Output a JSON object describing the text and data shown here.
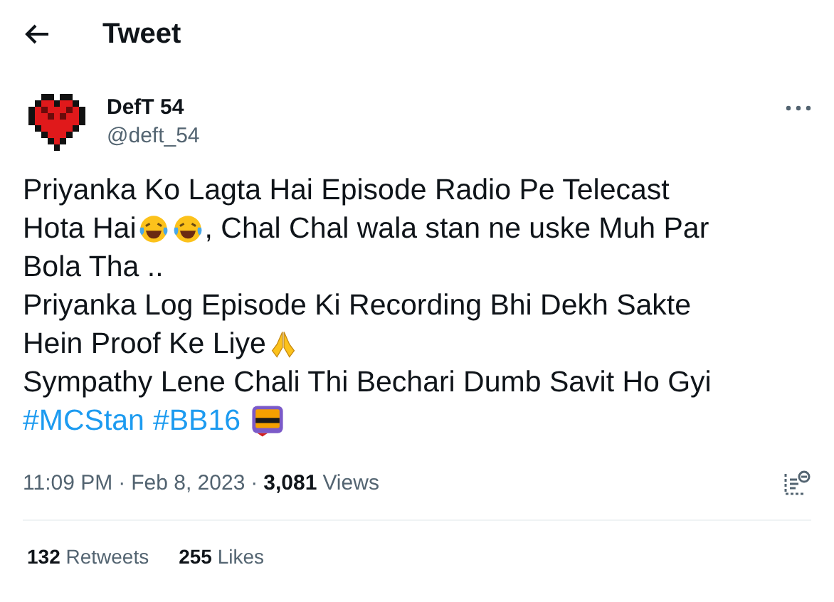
{
  "header": {
    "title": "Tweet"
  },
  "author": {
    "name": "DefT 54",
    "handle": "@deft_54"
  },
  "body": [
    [
      {
        "kind": "text",
        "text": "Priyanka Ko Lagta Hai Episode Radio Pe Telecast"
      }
    ],
    [
      {
        "kind": "text",
        "text": "Hota Hai"
      },
      {
        "kind": "laugh-emoji"
      },
      {
        "kind": "laugh-emoji"
      },
      {
        "kind": "text",
        "text": ", Chal Chal wala stan ne uske Muh Par"
      }
    ],
    [
      {
        "kind": "text",
        "text": "Bola Tha .."
      }
    ],
    [
      {
        "kind": "text",
        "text": "Priyanka Log Episode Ki Recording Bhi Dekh Sakte"
      }
    ],
    [
      {
        "kind": "text",
        "text": "Hein Proof Ke Liye"
      },
      {
        "kind": "pray-emoji"
      }
    ],
    [
      {
        "kind": "text",
        "text": "Sympathy Lene Chali Thi Bechari Dumb Savit Ho Gyi"
      }
    ],
    [
      {
        "kind": "hashtag",
        "text": "#MCStan"
      },
      {
        "kind": "hashtag",
        "text": "#BB16"
      },
      {
        "kind": "badge-emoji"
      }
    ]
  ],
  "meta": {
    "time": "11:09 PM",
    "separator_1": "·",
    "date": "Feb 8, 2023",
    "separator_2": "·",
    "views_count": "3,081",
    "views_label": "Views"
  },
  "stats": [
    {
      "count": "132",
      "label": "Retweets"
    },
    {
      "count": "255",
      "label": "Likes"
    }
  ]
}
